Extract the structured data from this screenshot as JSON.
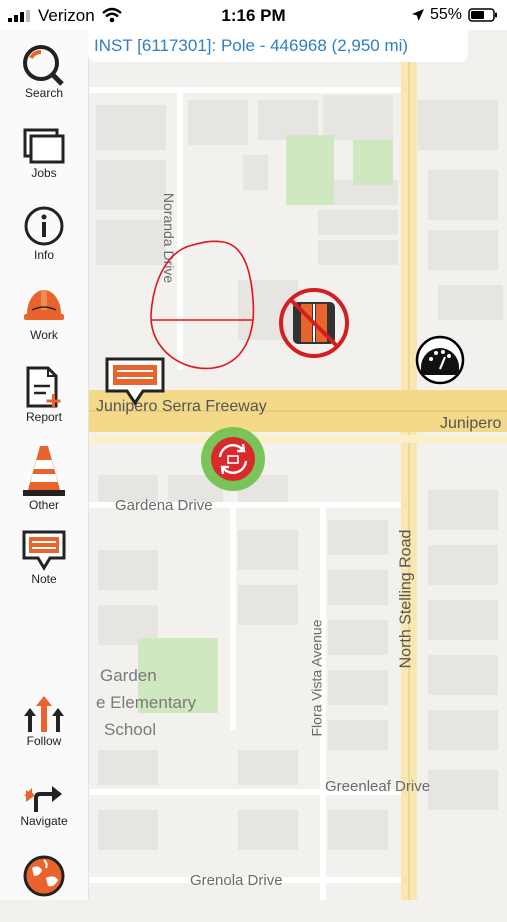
{
  "status_bar": {
    "carrier": "Verizon",
    "time": "1:16 PM",
    "battery_pct": "55%"
  },
  "banner": {
    "text": "INST [6117301]: Pole - 446968 (2,950 mi)"
  },
  "sidebar": {
    "items": [
      {
        "label": "Search",
        "icon": "search-icon"
      },
      {
        "label": "Jobs",
        "icon": "jobs-icon"
      },
      {
        "label": "Info",
        "icon": "info-icon"
      },
      {
        "label": "Work",
        "icon": "hardhat-icon"
      },
      {
        "label": "Report",
        "icon": "report-icon"
      },
      {
        "label": "Other",
        "icon": "traffic-cone-icon"
      },
      {
        "label": "Note",
        "icon": "note-icon"
      },
      {
        "label": "Follow",
        "icon": "follow-arrows-icon"
      },
      {
        "label": "Navigate",
        "icon": "navigate-icon"
      },
      {
        "label": "",
        "icon": "globe-icon"
      }
    ]
  },
  "map": {
    "roads": {
      "freeway_west": "Junipero Serra Freeway",
      "freeway_east": "Junipero",
      "noranda": "Noranda Drive",
      "gardena": "Gardena Drive",
      "stelling": "North Stelling Road",
      "flora_vista": "Flora Vista Avenue",
      "greenleaf": "Greenleaf Drive",
      "grenola": "Grenola Drive"
    },
    "poi": {
      "line1": "Garden",
      "line2": "e Elementary",
      "line3": "School"
    }
  },
  "colors": {
    "accent_orange": "#e8642c",
    "banner_blue": "#2f7fc1",
    "freeway": "#f4d98a",
    "road_major": "#f8e7b0",
    "park": "#cfe8c0",
    "sketch_red": "#e0151b"
  }
}
